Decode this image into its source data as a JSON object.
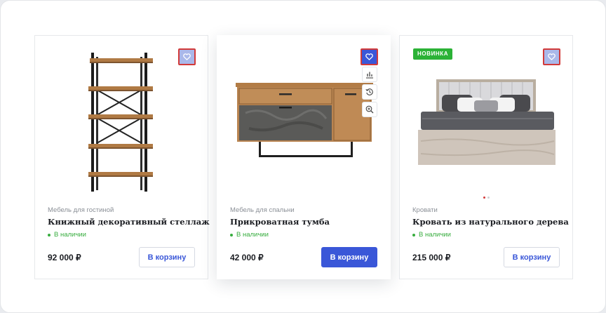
{
  "colors": {
    "accent": "#3a57d8",
    "favorite_border": "#d23a3a",
    "favorite_fill_inactive": "#aab8ea",
    "in_stock_green": "#38ad3f",
    "badge_green": "#2bb236"
  },
  "products": [
    {
      "category": "Мебель для гостиной",
      "title": "Книжный декоративный стеллаж",
      "stock": "В наличии",
      "price": "92 000 ₽",
      "cart_label": "В корзину",
      "favorite_icon": "heart-icon",
      "image": "wooden-shelf-rack"
    },
    {
      "category": "Мебель для спальни",
      "title": "Прикроватная тумба",
      "stock": "В наличии",
      "price": "42 000 ₽",
      "cart_label": "В корзину",
      "favorite_icon": "heart-icon",
      "tool_icons": [
        "compare-chart-icon",
        "history-icon",
        "zoom-in-icon"
      ],
      "image": "sideboard-dresser"
    },
    {
      "badge": "НОВИНКА",
      "category": "Кровати",
      "title": "Кровать из натурального дерева",
      "stock": "В наличии",
      "price": "215 000 ₽",
      "cart_label": "В корзину",
      "favorite_icon": "heart-icon",
      "image": "wooden-bed",
      "carousel": {
        "slides": 2,
        "active": 1
      }
    }
  ]
}
